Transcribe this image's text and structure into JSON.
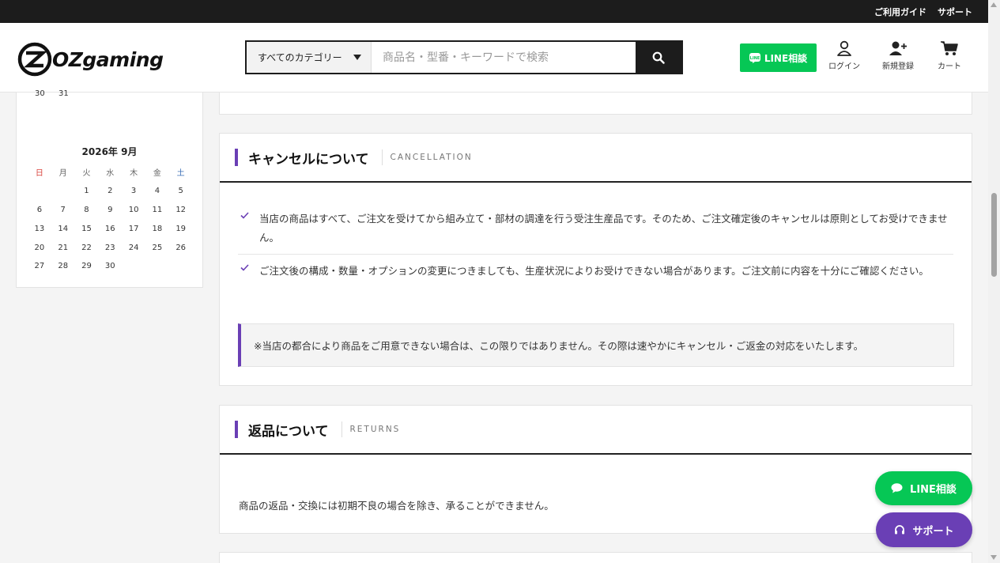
{
  "topbar": {
    "links": [
      "ご利用ガイド",
      "サポート"
    ]
  },
  "header": {
    "logo_text": "OZgaming",
    "search": {
      "category": "すべてのカテゴリー",
      "placeholder": "商品名・型番・キーワードで検索"
    },
    "line_button": "LINE相談",
    "icons": [
      {
        "label": "ログイン",
        "icon": "user-icon"
      },
      {
        "label": "新規登録",
        "icon": "user-plus-icon"
      },
      {
        "label": "カート",
        "icon": "cart-icon"
      }
    ]
  },
  "calendar": {
    "prev_tail": [
      "30",
      "31"
    ],
    "title": "2026年 9月",
    "weekdays": [
      "日",
      "月",
      "火",
      "水",
      "木",
      "金",
      "土"
    ],
    "weeks": [
      [
        "",
        "",
        "1",
        "2",
        "3",
        "4",
        "5"
      ],
      [
        "6",
        "7",
        "8",
        "9",
        "10",
        "11",
        "12"
      ],
      [
        "13",
        "14",
        "15",
        "16",
        "17",
        "18",
        "19"
      ],
      [
        "20",
        "21",
        "22",
        "23",
        "24",
        "25",
        "26"
      ],
      [
        "27",
        "28",
        "29",
        "30",
        "",
        "",
        ""
      ]
    ]
  },
  "cancellation": {
    "title": "キャンセルについて",
    "subtitle": "CANCELLATION",
    "items": [
      "当店の商品はすべて、ご注文を受けてから組み立て・部材の調達を行う受注生産品です。そのため、ご注文確定後のキャンセルは原則としてお受けできません。",
      "ご注文後の構成・数量・オプションの変更につきましても、生産状況によりお受けできない場合があります。ご注文前に内容を十分にご確認ください。"
    ],
    "note": "※当店の都合により商品をご用意できない場合は、この限りではありません。その際は速やかにキャンセル・ご返金の対応をいたします。"
  },
  "returns": {
    "title": "返品について",
    "subtitle": "RETURNS",
    "text": "商品の返品・交換には初期不良の場合を除き、承ることができません。"
  },
  "floating": {
    "line": "LINE相談",
    "support": "サポート"
  },
  "colors": {
    "accent": "#6a3fb5",
    "line_green": "#06c755",
    "dark": "#1c1c1c"
  }
}
